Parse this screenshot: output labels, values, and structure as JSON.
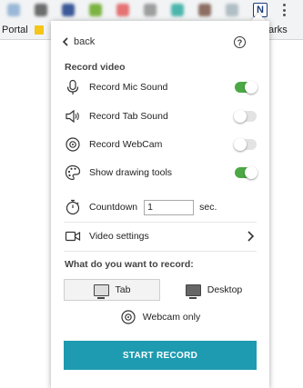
{
  "browser": {
    "bookmark_portal": "Portal",
    "bookmark_right": "arks",
    "extension_letter": "N"
  },
  "popup": {
    "back_label": "back",
    "help_symbol": "?",
    "record_video_title": "Record video",
    "options": [
      {
        "label": "Record Mic Sound",
        "icon": "microphone-icon",
        "enabled": true
      },
      {
        "label": "Record Tab Sound",
        "icon": "speaker-icon",
        "enabled": false
      },
      {
        "label": "Record WebCam",
        "icon": "webcam-icon",
        "enabled": false
      },
      {
        "label": "Show drawing tools",
        "icon": "palette-icon",
        "enabled": true
      }
    ],
    "countdown": {
      "label": "Countdown",
      "value": "1",
      "unit": "sec."
    },
    "video_settings_label": "Video settings",
    "record_target_title": "What do you want to record:",
    "modes": [
      {
        "label": "Tab",
        "selected": true
      },
      {
        "label": "Desktop",
        "selected": false
      },
      {
        "label": "Webcam only",
        "selected": false
      }
    ],
    "start_button": "START RECORD"
  },
  "colors": {
    "toggle_on": "#4ca845",
    "toggle_off": "#e3e3e3",
    "start_button": "#1e9bb0"
  }
}
